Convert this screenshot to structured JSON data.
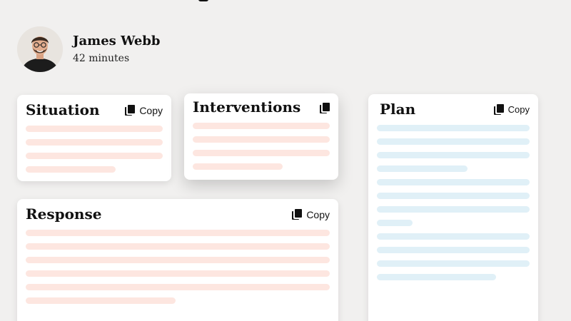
{
  "profile": {
    "name": "James Webb",
    "duration": "42 minutes"
  },
  "cards": {
    "situation": {
      "title": "Situation",
      "copy_label": "Copy",
      "line_count": 4
    },
    "interventions": {
      "title": "Interventions",
      "copy_label": "",
      "line_count": 4
    },
    "response": {
      "title": "Response",
      "copy_label": "Copy",
      "line_count": 6
    },
    "plan": {
      "title": "Plan",
      "copy_label": "Copy",
      "line_count": 12
    }
  },
  "colors": {
    "background": "#f1f0ef",
    "placeholder_pink": "#fde6e0",
    "placeholder_blue": "#e0f0f7"
  }
}
